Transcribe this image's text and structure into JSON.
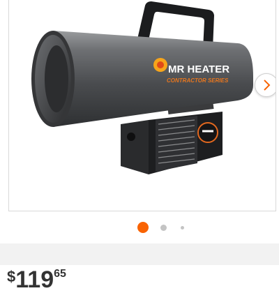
{
  "product": {
    "brand_text": "MR HEATER",
    "series_text": "CONTRACTOR SERIES"
  },
  "gallery": {
    "slide_count": 3,
    "active_index": 0,
    "next_icon": "chevron-right-icon"
  },
  "price": {
    "currency": "$",
    "dollars": "119",
    "cents": "65"
  },
  "colors": {
    "accent": "#f96302",
    "inactive_dot": "#c4c4c4",
    "band": "#f2f2f2",
    "border": "#d8d8d8"
  }
}
